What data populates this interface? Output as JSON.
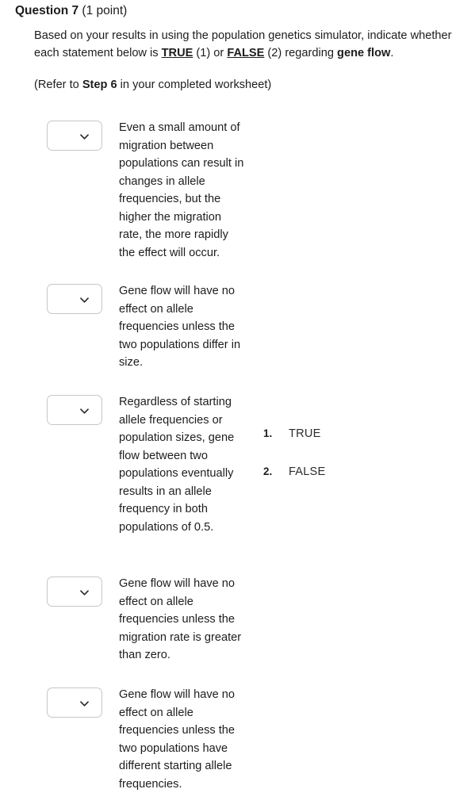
{
  "header": {
    "question_number": "Question 7",
    "points": "(1 point)"
  },
  "intro": {
    "part1": "Based on your results in using the population genetics simulator, indicate whether each statement below is ",
    "true_token": "TRUE",
    "part2": " (1) or ",
    "false_token": "FALSE",
    "part3": " (2) regarding ",
    "gene_flow_token": "gene flow",
    "part4": "."
  },
  "refer": {
    "part1": "(Refer to ",
    "step_token": "Step 6",
    "part2": " in your completed worksheet)"
  },
  "dropdown": {
    "icon": "chevron-down-icon",
    "value": "",
    "placeholder": ""
  },
  "statements": [
    {
      "text": "Even a small amount of migration between populations can result in changes in allele frequencies, but the higher the migration rate, the more rapidly the effect will occur."
    },
    {
      "text": "Gene flow will have no effect on allele frequencies unless the two populations differ in size."
    },
    {
      "text": "Regardless of starting allele frequencies or population sizes, gene flow between two populations eventually results in an allele frequency in both populations of 0.5."
    },
    {
      "text": "Gene flow will have no effect on allele frequencies unless the migration rate is greater than zero."
    },
    {
      "text": "Gene flow will have no effect on allele frequencies unless the two populations have different starting allele frequencies."
    }
  ],
  "answers": [
    {
      "number": "1.",
      "label": "TRUE"
    },
    {
      "number": "2.",
      "label": "FALSE"
    }
  ],
  "colors": {
    "text": "#1d1d1d",
    "border": "#c7c7c7",
    "background": "#ffffff"
  },
  "layout": {
    "row_tops": [
      152,
      358,
      498,
      727,
      867
    ],
    "text_tops": [
      150,
      356,
      496,
      725,
      865
    ],
    "answer_tops": [
      0,
      48
    ]
  }
}
